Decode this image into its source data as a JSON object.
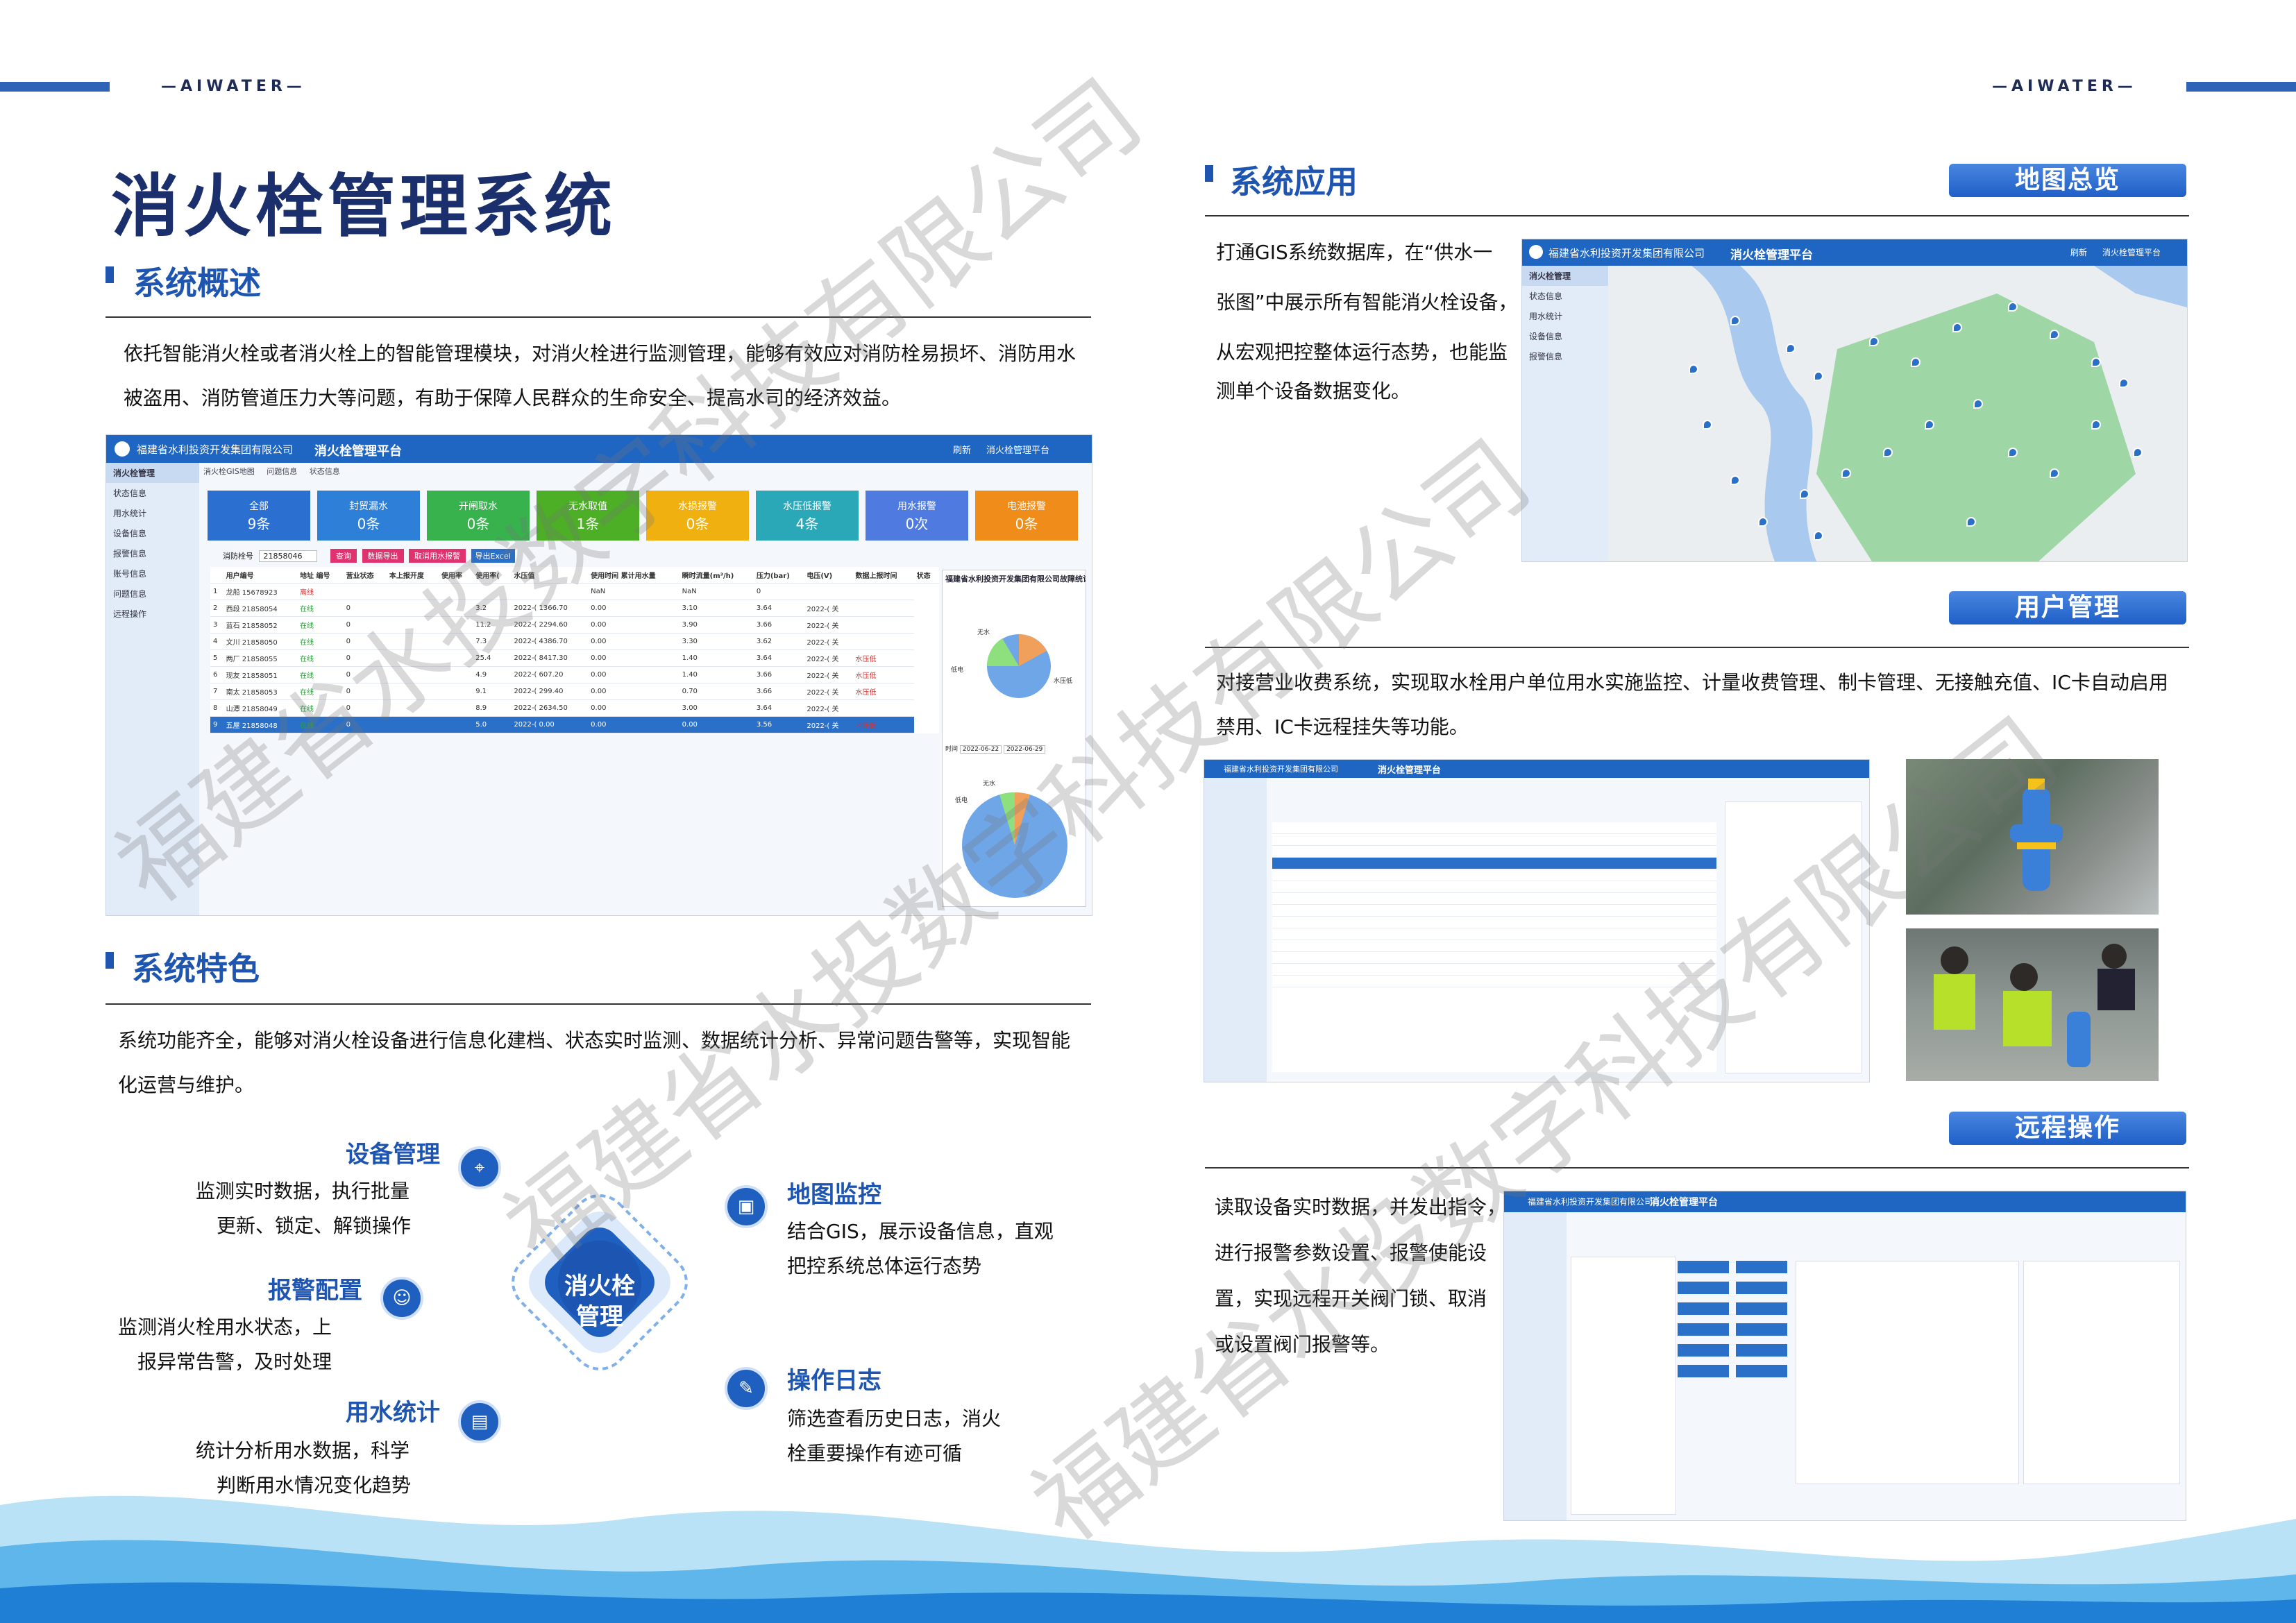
{
  "brand_left": "—AIWATER—",
  "brand_right": "—AIWATER—",
  "title": "消火栓管理系统",
  "overview": {
    "heading": "系统概述",
    "text_line1": "依托智能消火栓或者消火栓上的智能管理模块，对消火栓进行监测管理，能够有效应对消防栓易损坏、消防用水",
    "text_line2": "被盗用、消防管道压力大等问题，有助于保障人民群众的生命安全、提高水司的经济效益。"
  },
  "screenshot1": {
    "company": "福建省水利投资开发集团有限公司",
    "platform": "消火栓管理平台",
    "refresh": "刷新",
    "user": "消火栓管理平台",
    "side_items": [
      "消火栓管理",
      "状态信息",
      "用水统计",
      "设备信息",
      "报警信息",
      "账号信息",
      "问题信息",
      "远程操作"
    ],
    "tabs": [
      "消火栓GIS地图",
      "问题信息",
      "状态信息"
    ],
    "cards": [
      {
        "label": "全部",
        "value": "9条"
      },
      {
        "label": "封贸漏水",
        "value": "0条"
      },
      {
        "label": "开闸取水",
        "value": "0条"
      },
      {
        "label": "无水取值",
        "value": "1条"
      },
      {
        "label": "水损报警",
        "value": "0条"
      },
      {
        "label": "水压低报警",
        "value": "4条"
      },
      {
        "label": "用水报警",
        "value": "0次"
      },
      {
        "label": "电池报警",
        "value": "0条"
      }
    ],
    "search_label": "消防栓号",
    "search_value": "21858046",
    "btn_query": "查询",
    "btn_export": "数据导出",
    "btn_alarm": "取消用水报警",
    "btn_excel": "导出Excel",
    "header_cols": [
      "用户编号",
      "地址 编号",
      "营业状态",
      "本上报开度",
      "使用率",
      "使用率(",
      "水压值",
      "使用时间 累计用水量",
      "瞬时流量(m³/h)",
      "压力(bar)",
      "电压(V)",
      "数据上报时间",
      "状态"
    ],
    "rows": [
      [
        "1",
        "龙船 15678923",
        "离线",
        "",
        "",
        "",
        "",
        "",
        "NaN",
        "NaN",
        "0",
        "",
        ""
      ],
      [
        "2",
        "西段 21858054",
        "在线",
        "0",
        "",
        "",
        "3.2",
        "2022-( 1366.70",
        "0.00",
        "3.10",
        "3.64",
        "2022-( 关",
        ""
      ],
      [
        "3",
        "蓝石 21858052",
        "在线",
        "0",
        "",
        "",
        "11.2",
        "2022-( 2294.60",
        "0.00",
        "3.90",
        "3.66",
        "2022-( 关",
        ""
      ],
      [
        "4",
        "文川 21858050",
        "在线",
        "0",
        "",
        "",
        "7.3",
        "2022-( 4386.70",
        "0.00",
        "3.30",
        "3.62",
        "2022-( 关",
        ""
      ],
      [
        "5",
        "两厂 21858055",
        "在线",
        "0",
        "",
        "",
        "25.4",
        "2022-( 8417.30",
        "0.00",
        "1.40",
        "3.64",
        "2022-( 关",
        "水压低"
      ],
      [
        "6",
        "现友 21858051",
        "在线",
        "0",
        "",
        "",
        "4.9",
        "2022-( 607.20",
        "0.00",
        "1.40",
        "3.66",
        "2022-( 关",
        "水压低"
      ],
      [
        "7",
        "南太 21858053",
        "在线",
        "0",
        "",
        "",
        "9.1",
        "2022-( 299.40",
        "0.00",
        "0.70",
        "3.66",
        "2022-( 关",
        "水压低"
      ],
      [
        "8",
        "山潭 21858049",
        "在线",
        "0",
        "",
        "",
        "8.9",
        "2022-( 2634.50",
        "0.00",
        "3.00",
        "3.64",
        "2022-( 关",
        ""
      ],
      [
        "9",
        "五屋 21858048",
        "在线",
        "0",
        "",
        "",
        "5.0",
        "2022-( 0.00",
        "0.00",
        "0.00",
        "3.56",
        "2022-( 关",
        "水压低"
      ]
    ],
    "chart_title": "福建省水利投资开发集团有限公司故障统计",
    "pie1_labels": [
      "无水",
      "低电",
      "水压低"
    ],
    "date_label": "时间",
    "date_from": "2022-06-22",
    "date_to": "2022-06-29",
    "pie2_labels": [
      "无水",
      "低电"
    ]
  },
  "features": {
    "heading": "系统特色",
    "text_line1": "系统功能齐全，能够对消火栓设备进行信息化建档、状态实时监测、数据统计分析、异常问题告警等，实现智能",
    "text_line2": "化运营与维护。",
    "center_line1": "消火栓",
    "center_line2": "管理",
    "items": [
      {
        "title": "设备管理",
        "line1": "监测实时数据，执行批量",
        "line2": "更新、锁定、解锁操作"
      },
      {
        "title": "报警配置",
        "line1": "监测消火栓用水状态，上",
        "line2": "报异常告警，及时处理"
      },
      {
        "title": "用水统计",
        "line1": "统计分析用水数据，科学",
        "line2": "判断用水情况变化趋势"
      },
      {
        "title": "地图监控",
        "line1": "结合GIS，展示设备信息，直观",
        "line2": "把控系统总体运行态势"
      },
      {
        "title": "操作日志",
        "line1": "筛选查看历史日志，消火",
        "line2": "栓重要操作有迹可循"
      }
    ]
  },
  "application": {
    "heading": "系统应用",
    "map_tag": "地图总览",
    "map_text": [
      "打通GIS系统数据库，在“供水一",
      "张图”中展示所有智能消火栓设备，",
      "从宏观把控整体运行态势，也能监",
      "测单个设备数据变化。"
    ],
    "user_tag": "用户管理",
    "user_text_line1": "对接营业收费系统，实现取水栓用户单位用水实施监控、计量收费管理、制卡管理、无接触充值、IC卡自动启用",
    "user_text_line2": "禁用、IC卡远程挂失等功能。",
    "remote_tag": "远程操作",
    "remote_text": [
      "读取设备实时数据，并发出指令，",
      "进行报警参数设置、报警使能设",
      "置，实现远程开关阀门锁、取消",
      "或设置阀门报警等。"
    ]
  },
  "watermark": "福建省水投数字科技有限公司",
  "colors": {
    "primary": "#1e55b0",
    "title": "#1a2f6b",
    "card_colors": [
      "#2b6fd1",
      "#2e7fd8",
      "#37b24d",
      "#4caf26",
      "#f0b010",
      "#2aa8b8",
      "#4f7be0",
      "#f08c1a"
    ]
  }
}
